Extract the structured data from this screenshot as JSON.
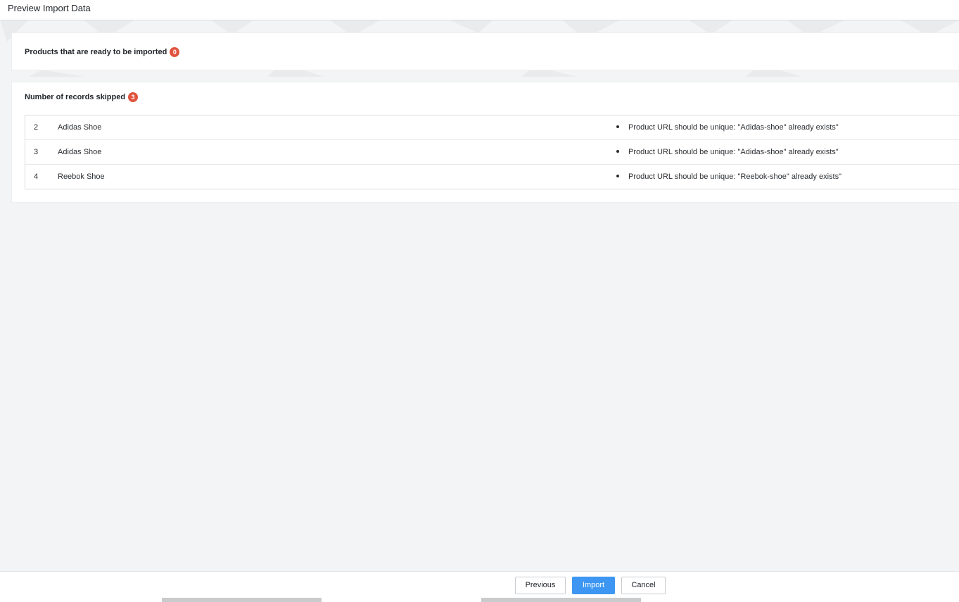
{
  "header": {
    "title": "Preview Import Data"
  },
  "ready_section": {
    "label": "Products that are ready to be imported",
    "count": "0"
  },
  "skipped_section": {
    "label": "Number of records skipped",
    "count": "3",
    "rows": [
      {
        "row_number": "2",
        "product_name": "Adidas Shoe",
        "error": "Product URL should be unique: \"Adidas-shoe\" already exists\""
      },
      {
        "row_number": "3",
        "product_name": "Adidas Shoe",
        "error": "Product URL should be unique: \"Adidas-shoe\" already exists\""
      },
      {
        "row_number": "4",
        "product_name": "Reebok Shoe",
        "error": "Product URL should be unique: \"Reebok-shoe\" already exists\""
      }
    ]
  },
  "footer": {
    "previous_label": "Previous",
    "import_label": "Import",
    "cancel_label": "Cancel"
  },
  "colors": {
    "badge": "#e0533f",
    "primary_button": "#3d97f2",
    "page_background": "#f3f4f5"
  }
}
